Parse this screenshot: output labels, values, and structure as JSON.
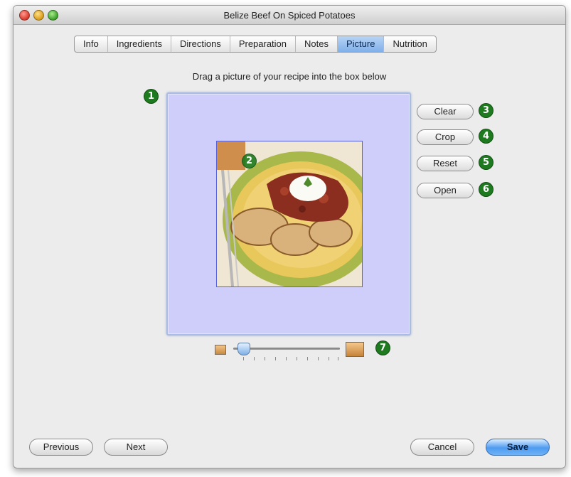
{
  "window": {
    "title": "Belize Beef On Spiced Potatoes"
  },
  "tabs": [
    {
      "label": "Info"
    },
    {
      "label": "Ingredients"
    },
    {
      "label": "Directions"
    },
    {
      "label": "Preparation"
    },
    {
      "label": "Notes"
    },
    {
      "label": "Picture",
      "active": true
    },
    {
      "label": "Nutrition"
    }
  ],
  "picture": {
    "prompt": "Drag a picture of your recipe into the box below",
    "image_subject": "beef-on-spiced-potatoes-photo"
  },
  "buttons": {
    "clear": "Clear",
    "crop": "Crop",
    "reset": "Reset",
    "open": "Open",
    "previous": "Previous",
    "next": "Next",
    "cancel": "Cancel",
    "save": "Save"
  },
  "markers": {
    "m1": "1",
    "m2": "2",
    "m3": "3",
    "m4": "4",
    "m5": "5",
    "m6": "6",
    "m7": "7"
  },
  "zoom_slider": {
    "value_fraction": 0.05
  },
  "colors": {
    "dropzone_bg": "#cfcdf9",
    "marker_green": "#1e7a1e",
    "active_tab": "#8fbcef",
    "default_button": "#4e9bf0"
  }
}
